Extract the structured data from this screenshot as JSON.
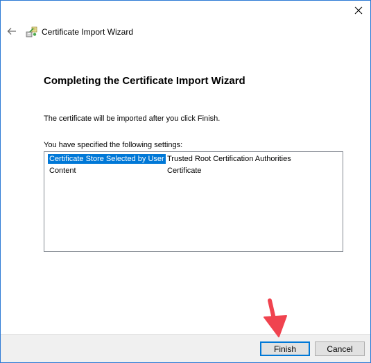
{
  "window": {
    "title": "Certificate Import Wizard"
  },
  "page": {
    "heading": "Completing the Certificate Import Wizard",
    "intro": "The certificate will be imported after you click Finish.",
    "settings_label": "You have specified the following settings:",
    "settings": [
      {
        "name": "Certificate Store Selected by User",
        "value": "Trusted Root Certification Authorities",
        "selected": true
      },
      {
        "name": "Content",
        "value": "Certificate",
        "selected": false
      }
    ]
  },
  "buttons": {
    "finish": "Finish",
    "cancel": "Cancel"
  },
  "icons": {
    "close": "close-icon",
    "back": "back-arrow-icon",
    "wizard": "certificate-wizard-icon",
    "annotation": "red-pointer-arrow-icon"
  },
  "colors": {
    "selection": "#0078d7",
    "window_border": "#2b79d5",
    "annotation_arrow": "#f0434f"
  }
}
